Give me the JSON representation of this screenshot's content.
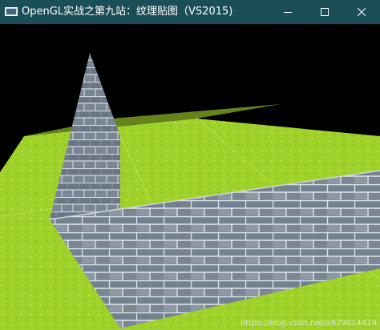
{
  "window": {
    "title": "OpenGL实战之第九站：纹理贴图（VS2015)",
    "titlebar_color": "#1b4f58",
    "buttons": {
      "minimize_icon": "minimize-icon",
      "maximize_icon": "maximize-icon",
      "close_icon": "close-icon"
    }
  },
  "scene": {
    "background_color": "#000000",
    "ground_color": "#9ed22a",
    "wall_color": "#7e8a98",
    "mortar_color": "#d9dde2"
  },
  "watermark": "https://blog.csdn.net/x879014419"
}
